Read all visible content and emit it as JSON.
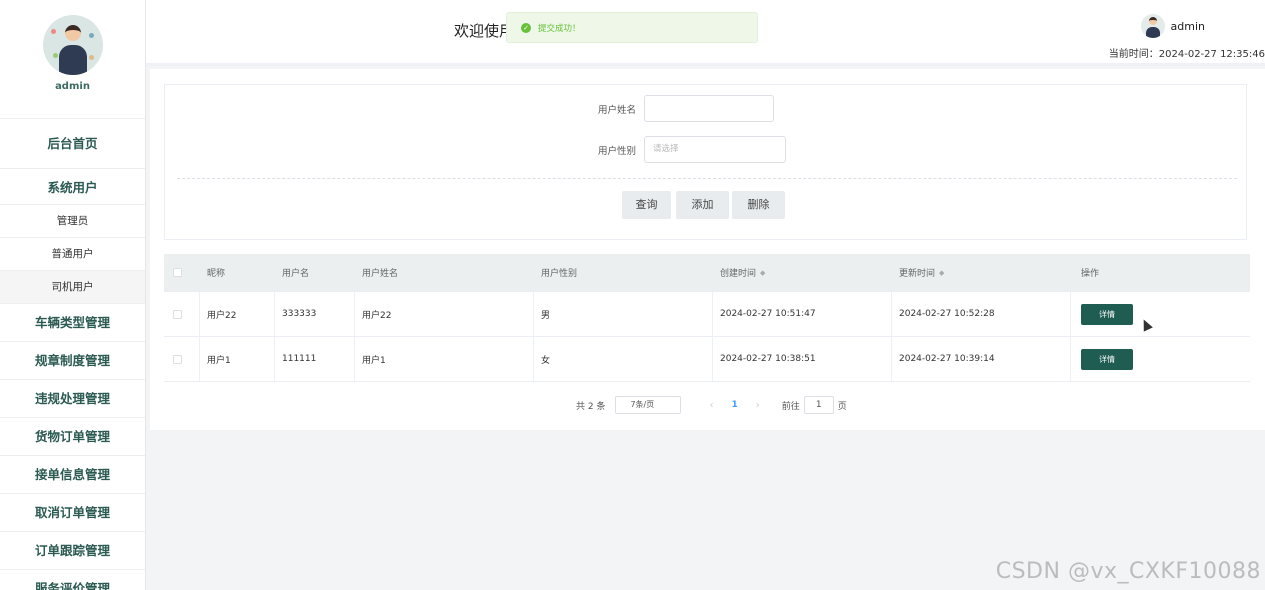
{
  "sidebar": {
    "username": "admin",
    "home": "后台首页",
    "group": "系统用户",
    "sub_items": [
      "管理员",
      "普通用户",
      "司机用户"
    ],
    "items": [
      "车辆类型管理",
      "规章制度管理",
      "违规处理管理",
      "货物订单管理",
      "接单信息管理",
      "取消订单管理",
      "订单跟踪管理",
      "服务评价管理"
    ]
  },
  "header": {
    "welcome": "欢迎使用",
    "toast": "提交成功！",
    "username": "admin",
    "time": "当前时间：2024-02-27 12:35:46"
  },
  "search": {
    "name_label": "用户姓名",
    "name_value": "",
    "gender_label": "用户性别",
    "gender_placeholder": "请选择",
    "query_button": "查询",
    "add_button": "添加",
    "delete_button": "删除"
  },
  "table": {
    "columns": [
      "昵称",
      "用户名",
      "用户姓名",
      "用户性别",
      "创建时间",
      "更新时间",
      "操作"
    ],
    "rows": [
      {
        "nickname": "用户22",
        "username": "333333",
        "realname": "用户22",
        "gender": "男",
        "created": "2024-02-27 10:51:47",
        "updated": "2024-02-27 10:52:28",
        "action": "详情"
      },
      {
        "nickname": "用户1",
        "username": "111111",
        "realname": "用户1",
        "gender": "女",
        "created": "2024-02-27 10:38:51",
        "updated": "2024-02-27 10:39:14",
        "action": "详情"
      }
    ]
  },
  "pager": {
    "total": "共 2 条",
    "page_size": "7条/页",
    "current": "1",
    "goto_label": "前往",
    "goto_value": "1",
    "page_unit": "页"
  },
  "watermark": "CSDN @vx_CXKF10088"
}
